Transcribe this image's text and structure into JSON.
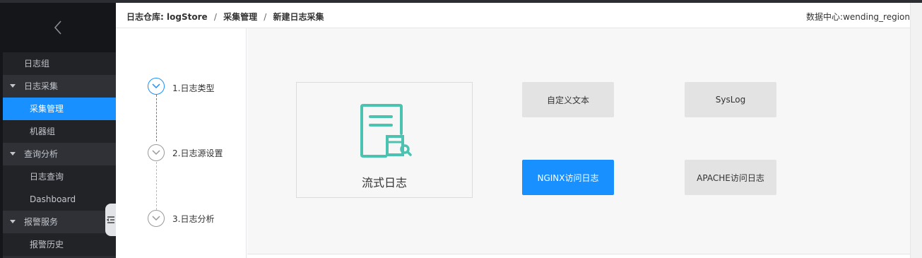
{
  "sidebar": {
    "collapse_icon": "chevron-left-icon",
    "items": [
      {
        "label": "日志组"
      },
      {
        "label": "日志采集"
      },
      {
        "label": "采集管理"
      },
      {
        "label": "机器组"
      },
      {
        "label": "查询分析"
      },
      {
        "label": "日志查询"
      },
      {
        "label": "Dashboard"
      },
      {
        "label": "报警服务"
      },
      {
        "label": "报警历史"
      }
    ]
  },
  "breadcrumb": {
    "root_prefix": "日志仓库:",
    "root_name": "logStore",
    "separator": "/",
    "level2": "采集管理",
    "level3": "新建日志采集"
  },
  "region": {
    "label": "数据中心:",
    "value": "wending_region"
  },
  "steps": [
    {
      "label": "1.日志类型",
      "active": true
    },
    {
      "label": "2.日志源设置",
      "active": false
    },
    {
      "label": "3.日志分析",
      "active": false
    }
  ],
  "main": {
    "stream_card": {
      "label": "流式日志",
      "icon": "log-document-search-icon",
      "color": "#4cc3b0"
    },
    "options": [
      {
        "label": "自定义文本",
        "selected": false
      },
      {
        "label": "SysLog",
        "selected": false
      },
      {
        "label": "NGINX访问日志",
        "selected": true
      },
      {
        "label": "APACHE访问日志",
        "selected": false
      }
    ]
  },
  "colors": {
    "accent": "#1890ff",
    "sidebar_bg": "#2b2d33",
    "stream_icon": "#4cc3b0"
  }
}
